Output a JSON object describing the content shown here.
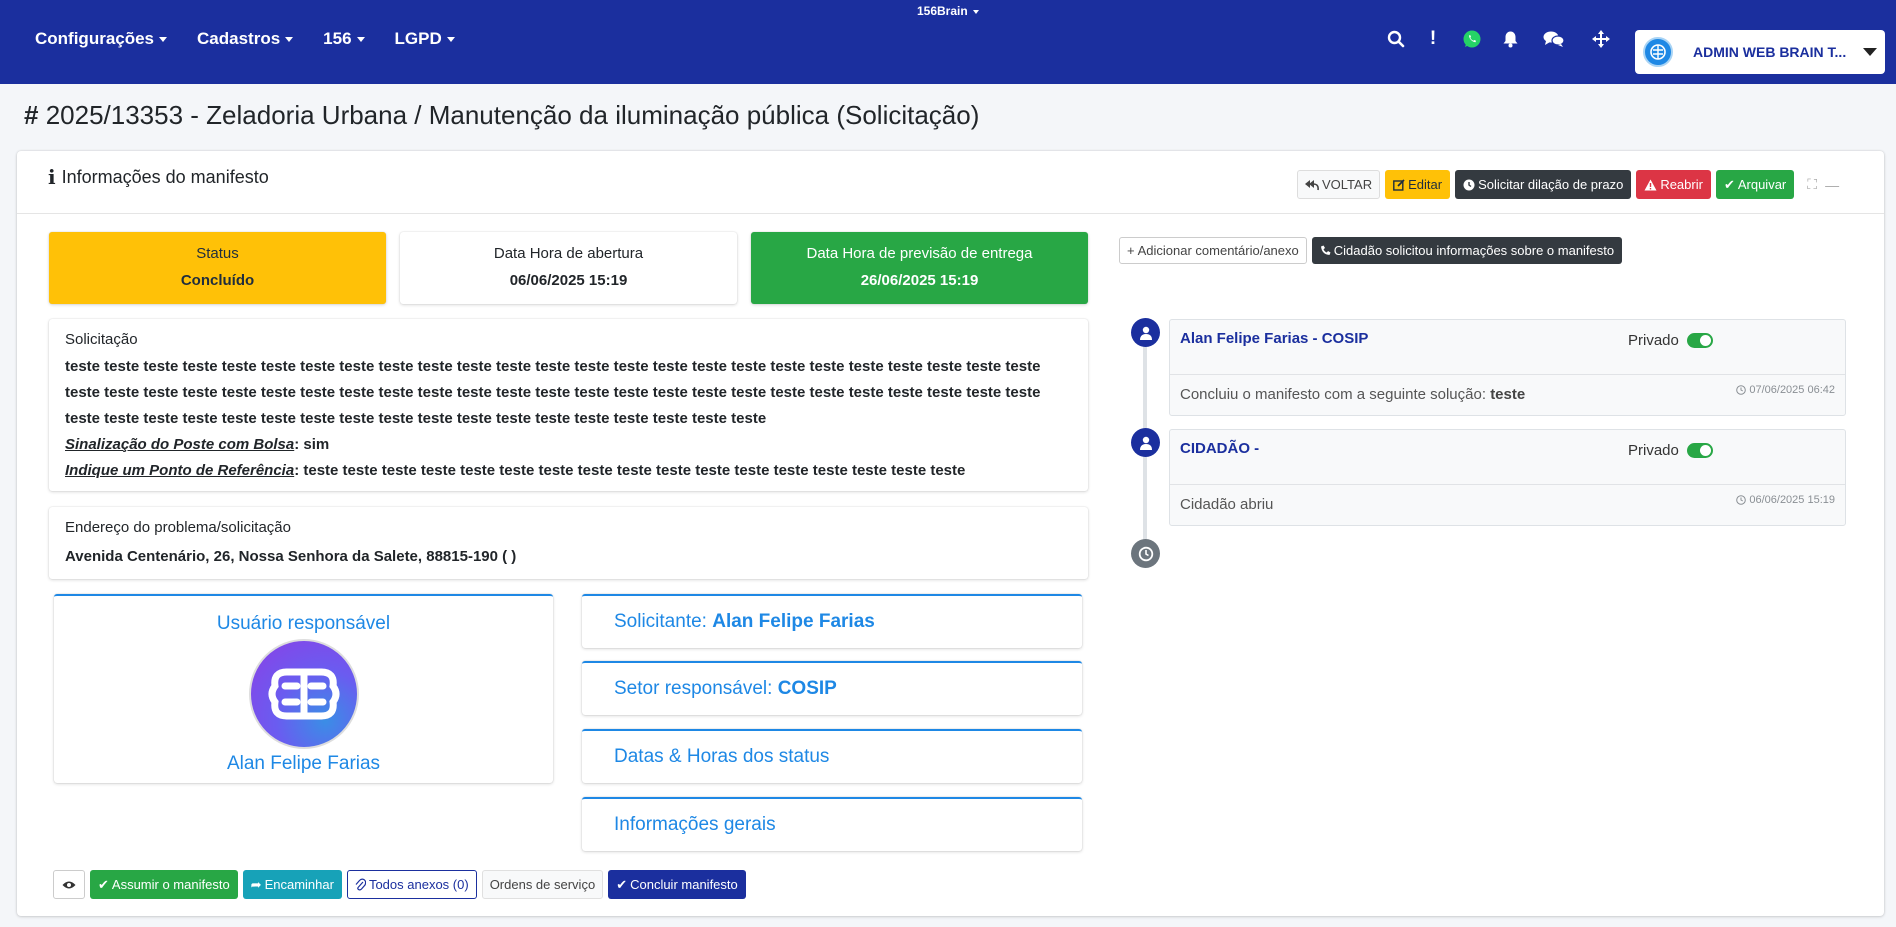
{
  "topbar": {
    "brand": "156Brain",
    "menu": [
      {
        "label": "Configurações"
      },
      {
        "label": "Cadastros"
      },
      {
        "label": "156"
      },
      {
        "label": "LGPD"
      }
    ],
    "user": {
      "name": "ADMIN WEB BRAIN T..."
    },
    "icons": [
      "search-icon",
      "exclamation-icon",
      "whatsapp-icon",
      "bell-icon",
      "chat-icon",
      "arrows-icon"
    ]
  },
  "page": {
    "title_hash": "#",
    "title": "2025/13353 - Zeladoria Urbana / Manutenção da iluminação pública (Solicitação)"
  },
  "card": {
    "title": "Informações do manifesto",
    "buttons": {
      "voltar": "VOLTAR",
      "editar": "Editar",
      "dilacao": "Solicitar dilação de prazo",
      "reabrir": "Reabrir",
      "arquivar": "Arquivar"
    }
  },
  "status_boxes": {
    "status": {
      "label": "Status",
      "value": "Concluído",
      "color": "#ffc107"
    },
    "abertura": {
      "label": "Data Hora de abertura",
      "value": "06/06/2025 15:19"
    },
    "previsao": {
      "label": "Data Hora de previsão de entrega",
      "value": "26/06/2025 15:19",
      "color": "#28a745"
    }
  },
  "solicitacao": {
    "title": "Solicitação",
    "text": "teste teste teste teste teste teste teste teste teste teste teste teste teste teste teste teste teste teste teste teste teste teste teste teste teste teste teste teste teste teste teste teste teste teste teste teste teste teste teste teste teste teste teste teste teste teste teste teste teste teste teste teste teste teste teste teste teste teste teste teste teste teste teste teste teste teste teste teste",
    "fields": [
      {
        "name": "Sinalização do Poste com Bolsa",
        "value": "sim"
      },
      {
        "name": "Indique um Ponto de Referência",
        "value": "teste teste teste teste teste teste teste teste teste teste teste teste teste teste teste teste teste"
      }
    ]
  },
  "endereco": {
    "title": "Endereço do problema/solicitação",
    "value": "Avenida Centenário, 26, Nossa Senhora da Salete, 88815-190 ( )"
  },
  "responsavel": {
    "title": "Usuário responsável",
    "name": "Alan Felipe Farias"
  },
  "accordions": {
    "solicitante": {
      "label": "Solicitante:",
      "value": "Alan Felipe Farias"
    },
    "setor": {
      "label": "Setor responsável:",
      "value": "COSIP"
    },
    "datas": {
      "label": "Datas & Horas dos status"
    },
    "info": {
      "label": "Informações gerais"
    }
  },
  "bottom_buttons": {
    "assumir": "Assumir o manifesto",
    "encaminhar": "Encaminhar",
    "anexos": "Todos anexos (0)",
    "ordens": "Ordens de serviço",
    "concluir": "Concluir manifesto"
  },
  "timeline": {
    "add_comment": "Adicionar comentário/anexo",
    "cidadao_info": "Cidadão solicitou informações sobre o manifesto",
    "items": [
      {
        "who": "Alan Felipe Farias - COSIP",
        "privacy": "Privado",
        "text_prefix": "Concluiu o manifesto com a seguinte solução:",
        "text_bold": "teste",
        "time": "07/06/2025 06:42"
      },
      {
        "who": "CIDADÃO -",
        "privacy": "Privado",
        "text_prefix": "Cidadão abriu",
        "text_bold": "",
        "time": "06/06/2025 15:19"
      }
    ]
  }
}
